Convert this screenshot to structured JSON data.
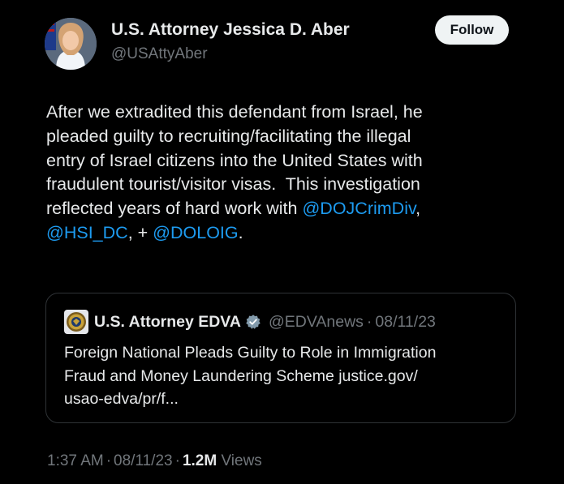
{
  "author": {
    "display_name": "U.S. Attorney Jessica D. Aber",
    "handle": "@USAttyAber",
    "follow_label": "Follow"
  },
  "tweet": {
    "lines": [
      [
        "After we extradited this defendant from Israel, he"
      ],
      [
        "pleaded guilty to recruiting/facilitating the illegal"
      ],
      [
        "entry of Israel citizens into the United States with"
      ],
      [
        "fraudulent tourist/visitor visas.  This investigation"
      ],
      [
        "reflected years of hard work with ",
        "@DOJCrimDiv",
        ","
      ],
      [
        "@HSI_DC",
        ", + ",
        "@DOLOIG",
        "."
      ]
    ]
  },
  "quote": {
    "name": "U.S. Attorney EDVA",
    "handle": "@EDVAnews",
    "dot": "·",
    "date": "08/11/23",
    "lines": [
      "Foreign National Pleads Guilty to Role in Immigration",
      "Fraud and Money Laundering Scheme justice.gov/",
      "usao-edva/pr/f..."
    ]
  },
  "meta": {
    "time": "1:37 AM",
    "sep": "·",
    "date": "08/11/23",
    "views_count": "1.2M",
    "views_label": "Views"
  },
  "icons": {
    "verified": "verified-badge-icon",
    "quote_avatar": "doj-seal-icon"
  },
  "colors": {
    "background": "#000000",
    "text": "#e7e9ea",
    "secondary": "#71767b",
    "link": "#1d9bf0",
    "follow_bg": "#eff3f4",
    "border": "#2f3336"
  }
}
